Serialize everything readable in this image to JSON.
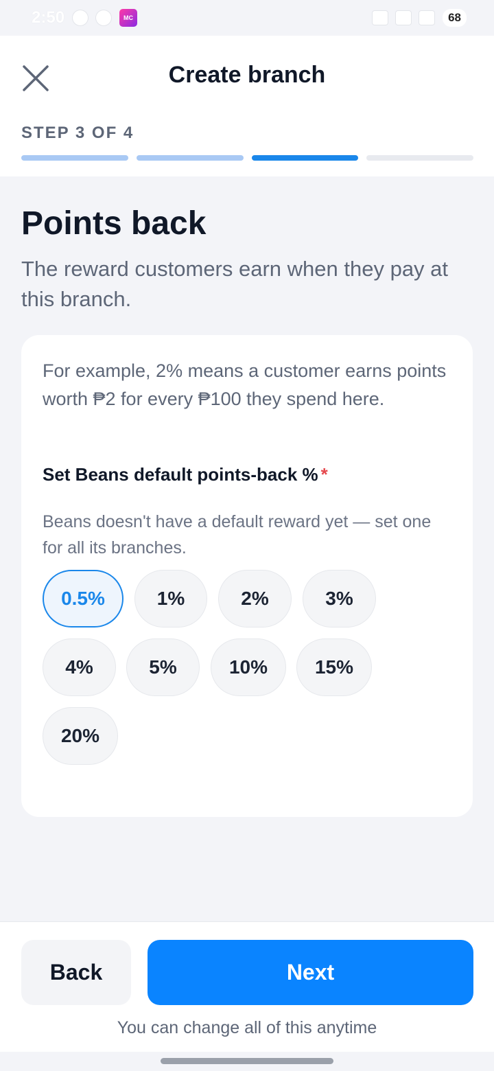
{
  "status_bar": {
    "time": "2:50",
    "app_badge": "MC",
    "battery": "68"
  },
  "header": {
    "title": "Create branch",
    "close_icon": "close-icon",
    "step_label": "STEP 3 OF 4",
    "progress": {
      "current_step": 3,
      "total_steps": 4
    }
  },
  "section": {
    "title": "Points back",
    "description": "The reward customers earn when they pay at this branch."
  },
  "card": {
    "example": "For example, 2% means a customer earns points worth ₱2 for every ₱100 they spend here.",
    "field_label": "Set Beans default points-back %",
    "required_mark": "*",
    "field_help": "Beans doesn't have a default reward yet — set one for all its branches.",
    "options": [
      "0.5%",
      "1%",
      "2%",
      "3%",
      "4%",
      "5%",
      "10%",
      "15%",
      "20%"
    ],
    "selected": "0.5%"
  },
  "footer": {
    "back_label": "Back",
    "next_label": "Next",
    "note": "You can change all of this anytime"
  },
  "colors": {
    "accent": "#0a84ff",
    "selected_chip": "#1a87ea",
    "progress_done": "#a9c9f4",
    "required": "#e5484d"
  }
}
